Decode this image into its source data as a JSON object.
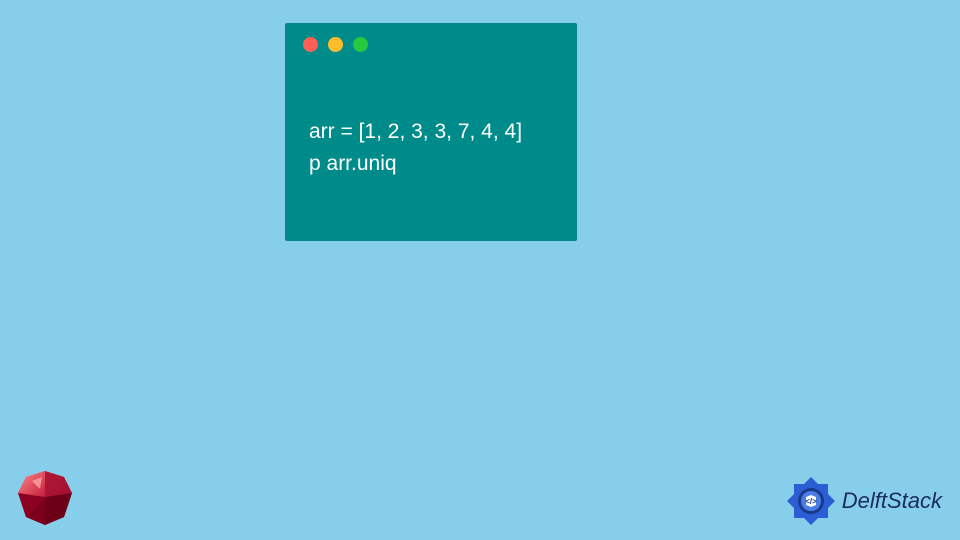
{
  "code": {
    "line1": "arr = [1, 2, 3, 3, 7, 4, 4]",
    "line2": "p arr.uniq"
  },
  "branding": {
    "site_name": "DelftStack"
  },
  "colors": {
    "background": "#87CEEB",
    "window": "#008B8B",
    "ruby": "#C41E3A",
    "delft_blue": "#2b5dd4",
    "delft_dark": "#1a2b5e"
  }
}
